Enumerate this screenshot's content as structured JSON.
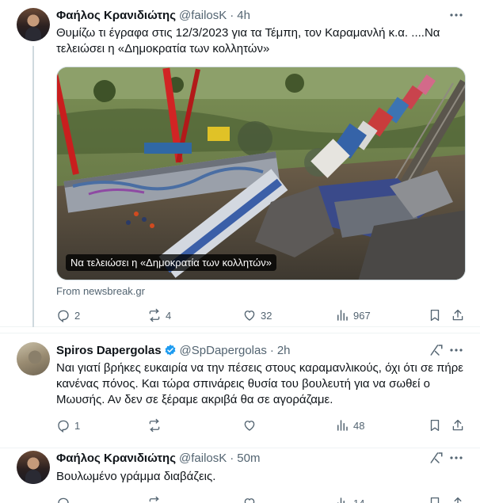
{
  "tweets": [
    {
      "author": "Φαήλος Κρανιδιώτης",
      "handle": "@failosK",
      "time": "4h",
      "text": "Θυμίζω τι έγραφα στις 12/3/2023 για τα Τέμπη, τον Καραμανλή κ.α. ....Να τελειώσει η «Δημοκρατία των κολλητών»",
      "media_caption": "Να τελειώσει η «Δημοκρατία των κολλητών»",
      "source": "From newsbreak.gr",
      "replies": "2",
      "reposts": "4",
      "likes": "32",
      "views": "967"
    },
    {
      "author": "Spiros Dapergolas",
      "handle": "@SpDapergolas",
      "time": "2h",
      "verified": true,
      "text": "Ναι γιατί βρήκες ευκαιρία να την πέσεις στους καραμανλικούς, όχι ότι σε πήρε κανένας πόνος. Και τώρα σπινάρεις θυσία του βουλευτή για να σωθεί ο Μωυσής. Αν δεν σε ξέραμε ακριβά θα σε αγοράζαμε.",
      "replies": "1",
      "reposts": "",
      "likes": "",
      "views": "48"
    },
    {
      "author": "Φαήλος Κρανιδιώτης",
      "handle": "@failosK",
      "time": "50m",
      "text": "Βουλωμένο γράμμα διαβάζεις.",
      "views": "14"
    }
  ],
  "dot": "·",
  "colors": {
    "text": "#0f1419",
    "muted": "#536471",
    "verified": "#1d9bf0",
    "border": "#eff3f4"
  },
  "icons": [
    "more-icon",
    "reply-icon",
    "repost-icon",
    "like-icon",
    "views-icon",
    "bookmark-icon",
    "share-icon",
    "grok-icon",
    "verified-badge-icon"
  ]
}
